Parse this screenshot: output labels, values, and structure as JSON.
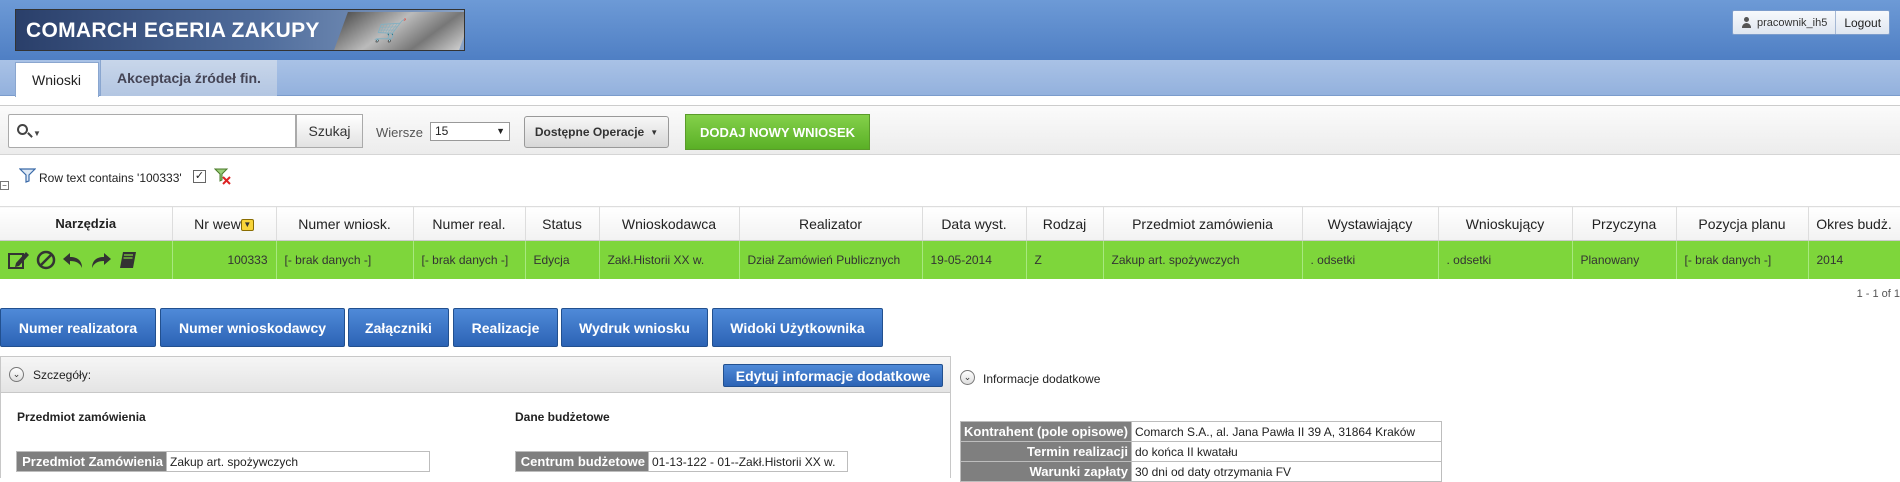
{
  "app": {
    "logo_text": "COMARCH EGERIA ZAKUPY",
    "user": "pracownik_ih5",
    "logout": "Logout"
  },
  "tabs": [
    {
      "label": "Wnioski",
      "active": true
    },
    {
      "label": "Akceptacja źródeł fin.",
      "active": false
    }
  ],
  "toolbar": {
    "search_value": "",
    "search_button": "Szukaj",
    "rows_label": "Wiersze",
    "rows_value": "15",
    "operations_label": "Dostępne Operacje",
    "add_button": "DODAJ NOWY WNIOSEK"
  },
  "filter": {
    "text": "Row text contains '100333'",
    "enabled": true
  },
  "grid": {
    "columns": [
      "Narzędzia",
      "Nr wew",
      "Numer wniosk.",
      "Numer real.",
      "Status",
      "Wnioskodawca",
      "Realizator",
      "Data wyst.",
      "Rodzaj",
      "Przedmiot zamówienia",
      "Wystawiający",
      "Wnioskujący",
      "Przyczyna",
      "Pozycja planu",
      "Okres budż."
    ],
    "rows": [
      {
        "tools": [
          "edit-icon",
          "cancel-icon",
          "undo-icon",
          "redo-icon",
          "book-icon"
        ],
        "nr_wew": "100333",
        "numer_wniosk": "[- brak danych -]",
        "numer_real": "[- brak danych -]",
        "status": "Edycja",
        "wnioskodawca": "Zakł.Historii XX w.",
        "realizator": "Dział Zamówień Publicznych",
        "data_wyst": "19-05-2014",
        "rodzaj": "Z",
        "przedmiot": "Zakup art. spożywczych",
        "wystawiajacy": ". odsetki",
        "wnioskujacy": ". odsetki",
        "przyczyna": "Planowany",
        "pozycja_planu": "[- brak danych -]",
        "okres": "2014"
      }
    ],
    "pager": "1 - 1 of 1",
    "row_color": "#7ed63b"
  },
  "actions": [
    "Numer realizatora",
    "Numer wnioskodawcy",
    "Załączniki",
    "Realizacje",
    "Wydruk wniosku",
    "Widoki Użytkownika"
  ],
  "details": {
    "title": "Szczegóły:",
    "edit_button": "Edytuj informacje dodatkowe",
    "section_order": "Przedmiot zamówienia",
    "section_budget": "Dane budżetowe",
    "order_key": "Przedmiot Zamówienia",
    "order_value": "Zakup art. spożywczych",
    "budget_key": "Centrum budżetowe",
    "budget_value": "01-13-122 - 01--Zakł.Historii XX w."
  },
  "extra_info": {
    "title": "Informacje dodatkowe",
    "rows": [
      {
        "key": "Kontrahent (pole opisowe)",
        "value": "Comarch S.A., al. Jana Pawła II 39 A, 31864 Kraków"
      },
      {
        "key": "Termin realizacji",
        "value": "do końca II kwatału"
      },
      {
        "key": "Warunki zapłaty",
        "value": "30 dni od daty otrzymania FV"
      }
    ]
  }
}
